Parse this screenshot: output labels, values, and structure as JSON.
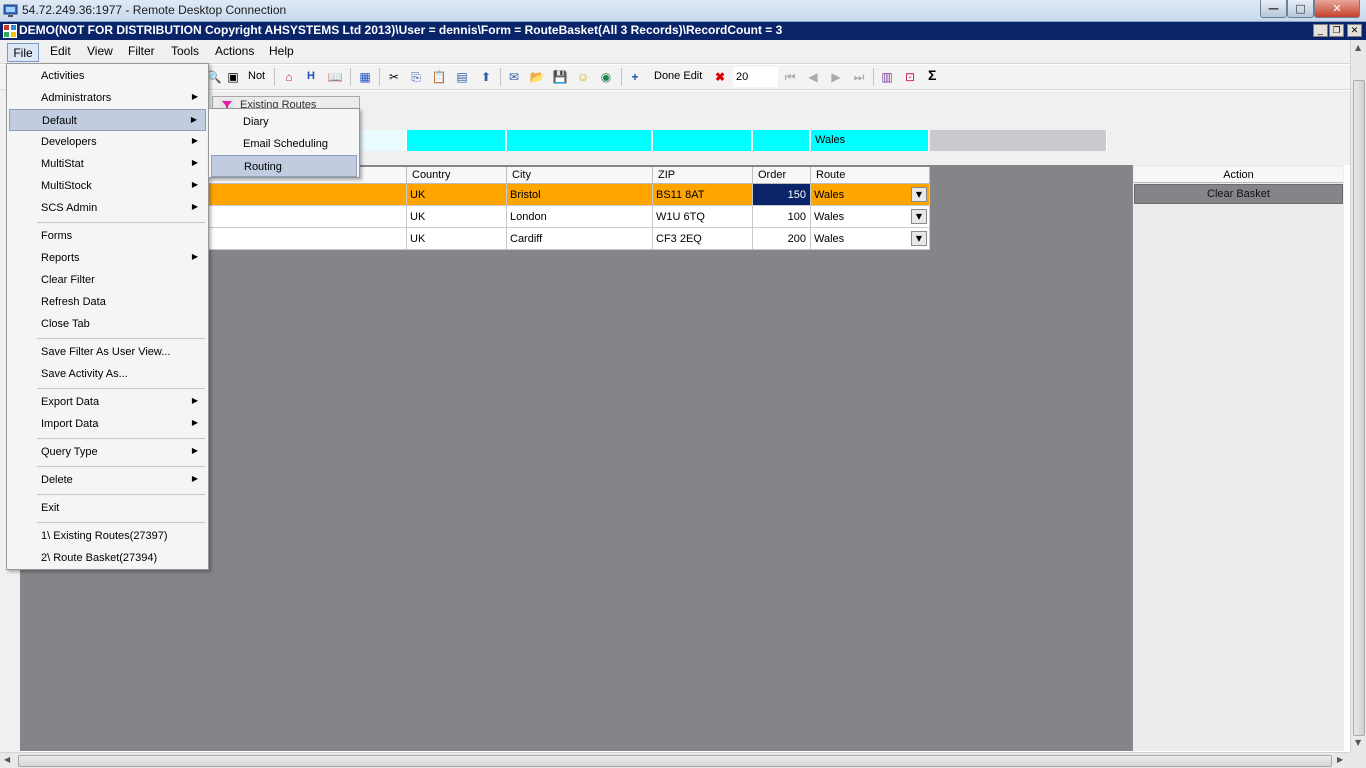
{
  "rdp": {
    "title": "54.72.249.36:1977 - Remote Desktop Connection",
    "min": "—",
    "max": "□",
    "close": "✕"
  },
  "app": {
    "title": "DEMO(NOT FOR DISTRIBUTION Copyright AHSYSTEMS Ltd 2013)\\User = dennis\\Form = RouteBasket(All 3 Records)\\RecordCount = 3"
  },
  "menubar": [
    "File",
    "Edit",
    "View",
    "Filter",
    "Tools",
    "Actions",
    "Help"
  ],
  "toolbar": {
    "not_label": "Not",
    "h_label": "H",
    "done_edit_label": "Done Edit",
    "rows_value": "20",
    "sigma": "Σ"
  },
  "tab": {
    "label": "Existing Routes"
  },
  "filter": {
    "route_value": "Wales"
  },
  "grid": {
    "columns": [
      "Country",
      "City",
      "ZIP",
      "Order",
      "Route"
    ],
    "rows": [
      {
        "country": "UK",
        "city": "Bristol",
        "zip": "BS11 8AT",
        "order": "150",
        "route": "Wales"
      },
      {
        "country": "UK",
        "city": "London",
        "zip": "W1U 6TQ",
        "order": "100",
        "route": "Wales"
      },
      {
        "country": "UK",
        "city": "Cardiff",
        "zip": "CF3 2EQ",
        "order": "200",
        "route": "Wales"
      }
    ]
  },
  "action_panel": {
    "header": "Action",
    "clear_basket": "Clear Basket"
  },
  "file_menu": {
    "items": [
      "Activities",
      "Administrators",
      "Default",
      "Developers",
      "MultiStat",
      "MultiStock",
      "SCS Admin",
      "Forms",
      "Reports",
      "Clear Filter",
      "Refresh Data",
      "Close Tab",
      "Save Filter As User View...",
      "Save Activity As...",
      "Export Data",
      "Import Data",
      "Query Type",
      "Delete",
      "Exit",
      "1\\ Existing Routes(27397)",
      "2\\ Route Basket(27394)"
    ]
  },
  "default_submenu": {
    "items": [
      "Diary",
      "Email Scheduling",
      "Routing"
    ]
  },
  "colors": {
    "selected_row": "#ffa500",
    "filter_cell": "#00ffff",
    "grid_bg": "#858488",
    "app_title_bg": "#0a246a",
    "order_cell_selected": "#0a246a"
  }
}
